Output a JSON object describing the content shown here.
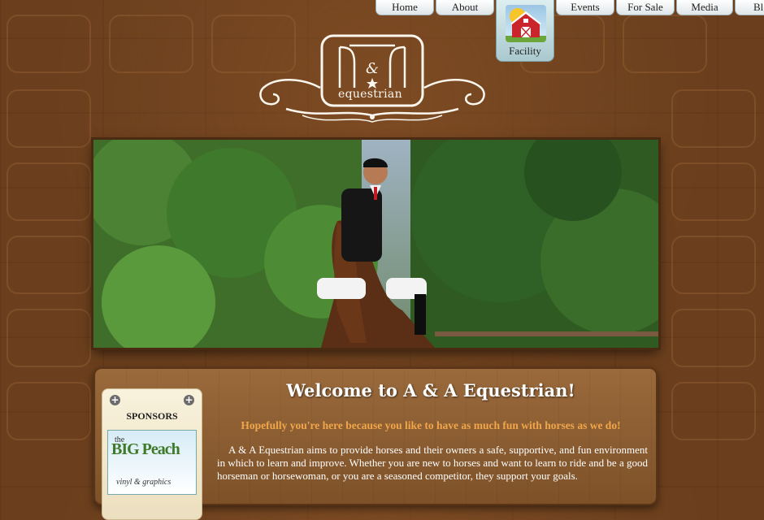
{
  "nav": {
    "items": [
      {
        "label": "Home"
      },
      {
        "label": "About"
      },
      {
        "label": "Facility"
      },
      {
        "label": "Events"
      },
      {
        "label": "For Sale"
      },
      {
        "label": "Media"
      },
      {
        "label": "Bl"
      }
    ],
    "active": "Facility",
    "active_icon": "barn-icon"
  },
  "logo": {
    "monogram": "A&A",
    "word": "equestrian",
    "icon": "a-and-a-equestrian-logo"
  },
  "hero": {
    "icon": "horse-and-rider-photo"
  },
  "sponsors": {
    "title": "SPONSORS",
    "logo": {
      "prefix": "the",
      "name": "BIG Peach",
      "subtitle": "vinyl & graphics"
    }
  },
  "main": {
    "title": "Welcome to A & A Equestrian!",
    "tagline": "Hopefully you're here because you like to have as much fun with horses as we do!",
    "intro": "A & A Equestrian aims to provide horses and their owners a safe, supportive, and fun environment in which to learn and improve. Whether you are new to horses and want to learn to ride and be a good horseman or horsewoman, or you are a seasoned competitor, they support your goals."
  },
  "colors": {
    "background": "#6b3f1d",
    "nav_tab": "#e8eef0",
    "active_tab": "#a9c9cf",
    "tagline": "#f0a64a",
    "text": "#ffffff"
  }
}
